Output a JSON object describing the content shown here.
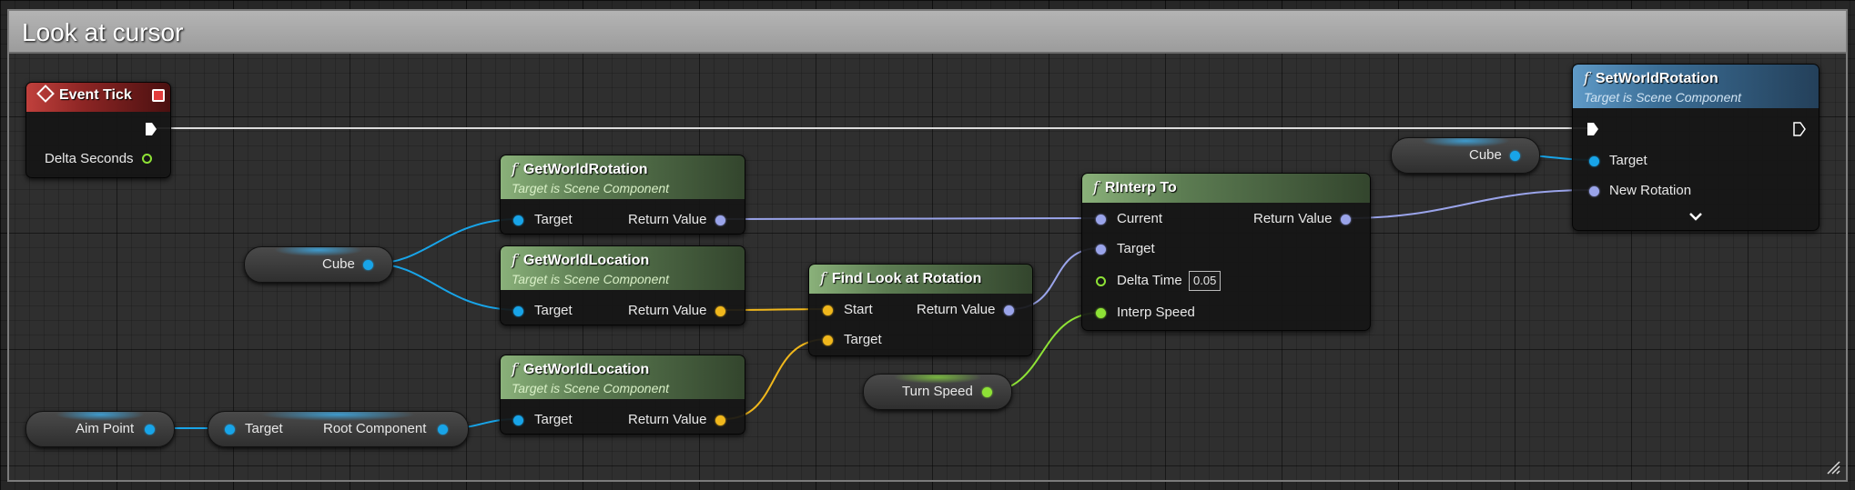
{
  "comment": {
    "title": "Look at cursor"
  },
  "nodes": {
    "event_tick": {
      "title": "Event Tick",
      "delta_seconds": "Delta Seconds"
    },
    "get_world_rotation": {
      "title": "GetWorldRotation",
      "subtitle": "Target is Scene Component",
      "target": "Target",
      "return_value": "Return Value"
    },
    "get_world_location_1": {
      "title": "GetWorldLocation",
      "subtitle": "Target is Scene Component",
      "target": "Target",
      "return_value": "Return Value"
    },
    "get_world_location_2": {
      "title": "GetWorldLocation",
      "subtitle": "Target is Scene Component",
      "target": "Target",
      "return_value": "Return Value"
    },
    "find_look_at_rotation": {
      "title": "Find Look at Rotation",
      "start": "Start",
      "target": "Target",
      "return_value": "Return Value"
    },
    "rinterp_to": {
      "title": "RInterp To",
      "current": "Current",
      "target": "Target",
      "delta_time": "Delta Time",
      "delta_time_value": "0.05",
      "interp_speed": "Interp Speed",
      "return_value": "Return Value"
    },
    "set_world_rotation": {
      "title": "SetWorldRotation",
      "subtitle": "Target is Scene Component",
      "target": "Target",
      "new_rotation": "New Rotation"
    }
  },
  "variables": {
    "cube_1": "Cube",
    "cube_2": "Cube",
    "aim_point": "Aim Point",
    "turn_speed": "Turn Speed"
  },
  "root_component_node": {
    "target": "Target",
    "root_component": "Root Component"
  },
  "icons": {
    "function": "function-icon",
    "event": "event-diamond-icon",
    "stop": "stop-icon",
    "exec": "exec-arrow-icon",
    "expand": "chevron-down-icon",
    "resize": "resize-grip-icon"
  },
  "colors": {
    "exec_wire": "#e6e6e6",
    "object_pin": "#18a4e8",
    "rotator_pin": "#9aa4ea",
    "vector_pin": "#f0b71c",
    "float_pin": "#8ee236",
    "event_header": "#b13a36",
    "function_header": "#6b8d5f",
    "target_function_header": "#3f77a4"
  }
}
